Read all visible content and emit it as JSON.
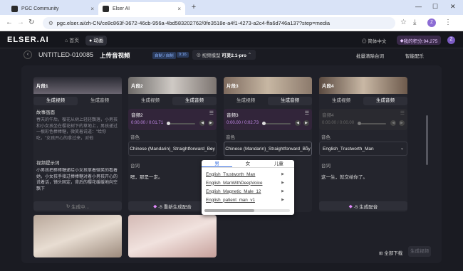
{
  "browser": {
    "tabs": [
      {
        "label": "PGC Community"
      },
      {
        "label": "Elser AI"
      }
    ],
    "url": "pgc.elser.ai/zh-CN/ce8c863f-3672-46cb-956a-4bd583202762/0fe3518e-a4f1-4273-a2c4-ffa6d746a137?step=media"
  },
  "app": {
    "logo": "ELSER.AI",
    "nav": [
      "首页",
      "动画"
    ],
    "lang": "简体中文",
    "credits": "我的积分:94,275",
    "avatar": "Z"
  },
  "project": {
    "name": "UNTITLED-010085",
    "step": "上传音视频",
    "badge1": "自制 / 自制",
    "badge2": "9:16",
    "model_label": "视频模型",
    "model_value": "可灵2.1-pro",
    "bulk_clear": "批量清除台词",
    "smart_match": "智能配乐"
  },
  "cards": [
    {
      "label": "片段1",
      "tab_video": "生成视频",
      "tab_audio": "生成音频",
      "story_title": "故事画面",
      "story_text": "春天的午后，樱花从树上轻轻飘落，小男孩和小女孩坐在樱花树下的草地上，男孩递过一根彩色棒棒糖，微笑着说道：\"给你吃，\"女孩开心的拿过来，对他",
      "prompt_title": "视频提示词",
      "prompt_text": "小男孩把棒棒糖递给小女孩拿着微笑的看着她，小女孩手接过棒棒糖对着小男孩开心的说着话，镜头固定，背后的樱花缓缓地向空飘下",
      "gen_btn": "生成中..."
    },
    {
      "label": "片段2",
      "tab_video": "生成视频",
      "tab_audio": "生成音频",
      "audio_name": "音频2",
      "audio_time": "0:00.00 / 0:01.71",
      "voice_label": "音色",
      "voice_value": "Chinese (Mandarin)_Straightforward_Boy",
      "line_label": "台词",
      "line_text": "嗯，那是一定。",
      "gen_btn": "-5 重新生成配音"
    },
    {
      "label": "片段3",
      "tab_video": "生成视频",
      "tab_audio": "生成音频",
      "audio_name": "音频3",
      "audio_time": "0:00.00 / 0:02.73",
      "voice_label": "音色",
      "voice_value": "Chinese (Mandarin)_Straightforward_Boy"
    },
    {
      "label": "片段4",
      "tab_video": "生成视频",
      "tab_audio": "生成音频",
      "audio_name": "音频4",
      "audio_time": "0:00.00 / 0:00.00",
      "voice_label": "音色",
      "voice_value": "English_Trustworth_Man",
      "line_label": "台词",
      "line_text": "这一生，就交给你了。",
      "gen_btn": "-5 生成配音"
    }
  ],
  "dropdown": {
    "tabs": [
      "男",
      "女",
      "儿童"
    ],
    "items": [
      "English_Trustworth_Man",
      "English_ManWithDeepVoice",
      "English_Magnetic_Male_12",
      "English_patient_man_v1"
    ]
  },
  "footer": {
    "download_all": "全部下载",
    "next": "生成视频"
  }
}
